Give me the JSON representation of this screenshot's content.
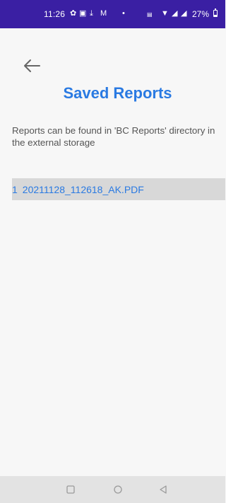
{
  "status_bar": {
    "time": "11:26",
    "battery_percent": "27%",
    "battery_level": 0.27,
    "icons": [
      "fan-icon",
      "app-notification-icon",
      "download-icon",
      "gmail-icon",
      "dot-icon",
      "wifi-calling-icon",
      "wifi-icon",
      "signal-icon",
      "signal-icon",
      "battery-icon"
    ]
  },
  "header": {
    "back_icon": "arrow-left-icon",
    "title": "Saved Reports"
  },
  "description": "Reports can be found in 'BC Reports' directory in the external storage",
  "reports": [
    {
      "index": "1",
      "filename": "20211128_112618_AK.PDF"
    }
  ],
  "nav_bar": {
    "icons": [
      "recent-apps-icon",
      "home-icon",
      "back-icon"
    ]
  },
  "colors": {
    "status_bar": "#3a1fa3",
    "accent": "#2a7ae2",
    "background": "#f7f7f7",
    "row_highlight": "#d8d8d8",
    "nav_bar": "#e3e3e3"
  }
}
